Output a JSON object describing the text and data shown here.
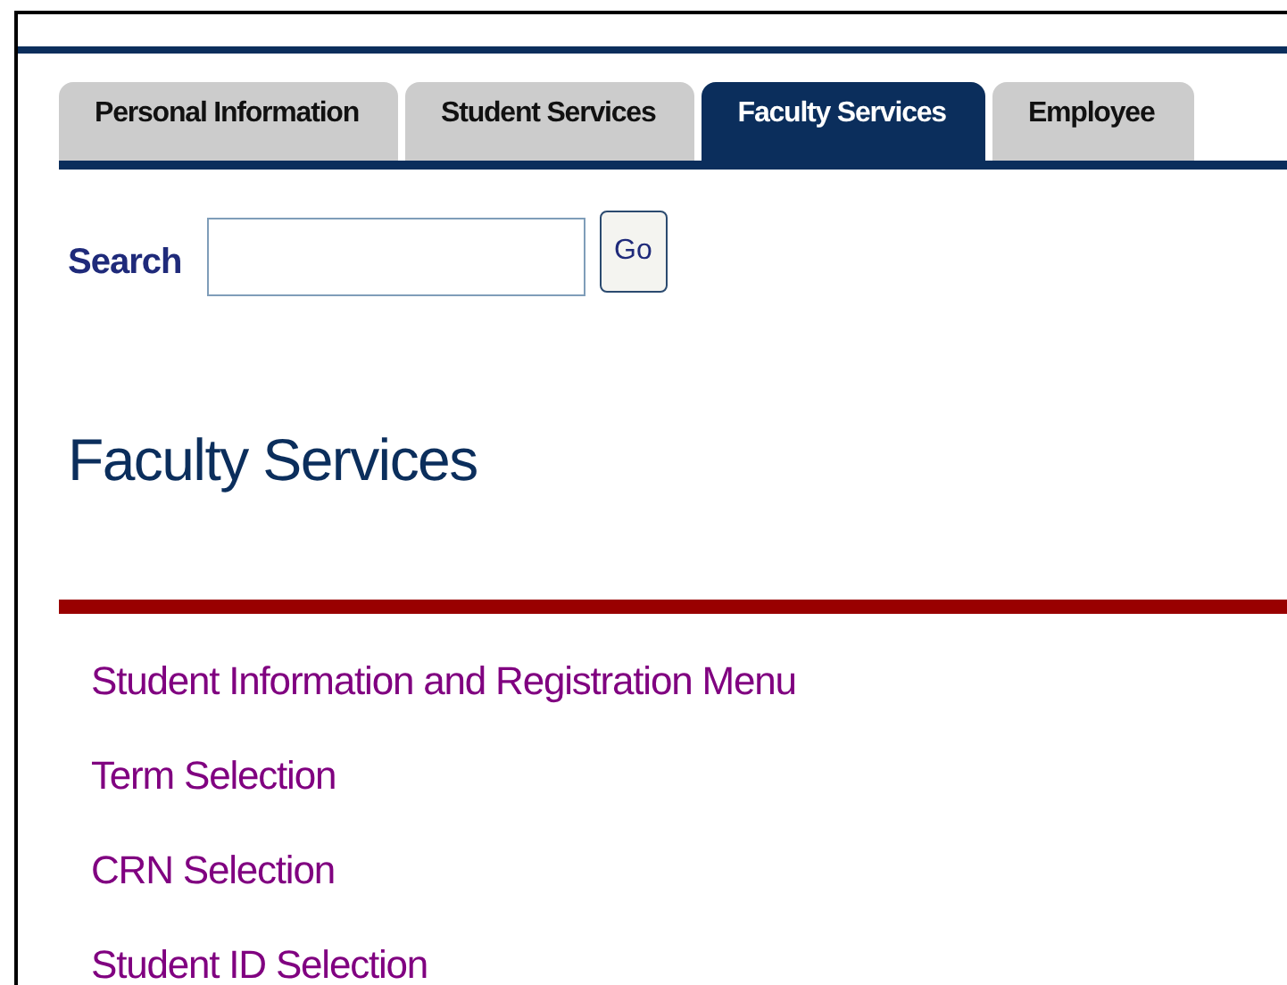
{
  "tabs": [
    {
      "label": "Personal Information",
      "selected": false
    },
    {
      "label": "Student Services",
      "selected": false
    },
    {
      "label": "Faculty Services",
      "selected": true
    },
    {
      "label": "Employee",
      "selected": false
    }
  ],
  "search": {
    "label": "Search",
    "button": "Go"
  },
  "heading": "Faculty Services",
  "links": [
    "Student Information and Registration Menu",
    "Term Selection",
    "CRN Selection",
    "Student ID Selection"
  ]
}
